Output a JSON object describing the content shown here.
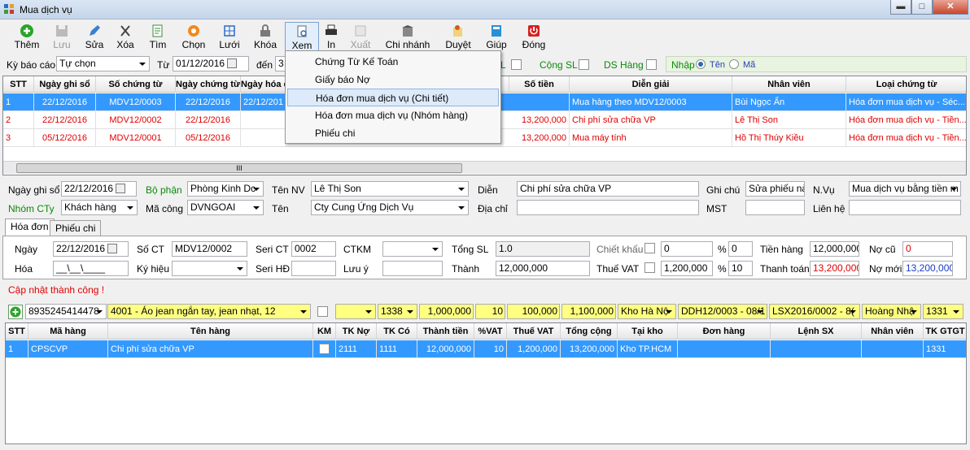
{
  "window": {
    "title": "Mua dịch vụ",
    "min": "▬",
    "max": "□",
    "close": "✕"
  },
  "toolbar": {
    "add": "Thêm",
    "save": "Lưu",
    "edit": "Sửa",
    "delete": "Xóa",
    "find": "Tìm",
    "choose": "Chọn",
    "grid": "Lưới",
    "lock": "Khóa",
    "view": "Xem",
    "print": "In",
    "export": "Xuất",
    "branch": "Chi nhánh",
    "approve": "Duyệt",
    "help": "Giúp",
    "close": "Đóng"
  },
  "filter": {
    "period_label": "Kỳ báo cáo",
    "period_value": "Tự chọn",
    "from_label": "Từ",
    "from_value": "01/12/2016",
    "to_label": "đến",
    "to_value": "3",
    "l_label": "L",
    "sum_qty_label": "Cộng SL",
    "ds_label": "DS Hàng",
    "input_label": "Nhập",
    "name_label": "Tên",
    "code_label": "Mã"
  },
  "view_menu": {
    "items": [
      "Chứng Từ Kế Toán",
      "Giấy báo Nợ",
      "Hóa đơn mua dịch vụ (Chi tiết)",
      "Hóa đơn mua dịch vụ (Nhóm hàng)",
      "Phiếu chi"
    ]
  },
  "top_grid": {
    "headers": [
      "STT",
      "Ngày ghi sổ",
      "Số chứng từ",
      "Ngày chứng từ",
      "Ngày hóa đ",
      "Số tiền",
      "Diễn giải",
      "Nhân viên",
      "Loại chứng từ"
    ],
    "rows": [
      {
        "stt": "1",
        "ngs": "22/12/2016",
        "sct": "MDV12/0003",
        "nct": "22/12/2016",
        "nhd": "22/12/201",
        "tien": "",
        "dg": "Mua hàng theo MDV12/0003",
        "nv": "Bùi Ngọc Ẩn",
        "loai": "Hóa đơn mua dịch vụ - Séc..."
      },
      {
        "stt": "2",
        "ngs": "22/12/2016",
        "sct": "MDV12/0002",
        "nct": "22/12/2016",
        "nhd": "",
        "tien": "13,200,000",
        "dg": "Chi phí sửa chữa VP",
        "nv": "Lê Thị Son",
        "loai": "Hóa đơn mua dịch vụ - Tiền..."
      },
      {
        "stt": "3",
        "ngs": "05/12/2016",
        "sct": "MDV12/0001",
        "nct": "05/12/2016",
        "nhd": "",
        "tien": "13,200,000",
        "dg": "Mua máy tính",
        "nv": "Hồ Thị Thúy Kiều",
        "loai": "Hóa đơn mua dịch vụ - Tiền..."
      }
    ],
    "scroll_marker": "III"
  },
  "form": {
    "ngs_label": "Ngày ghi sổ",
    "ngs_value": "22/12/2016",
    "bophan_label": "Bộ phận",
    "bophan_value": "Phòng Kinh Dc",
    "tennv_label": "Tên NV",
    "tennv_value": "Lê Thị Son",
    "dien_label": "Diễn",
    "dien_value": "Chi phí sửa chữa VP",
    "ghichu_label": "Ghi chú",
    "ghichu_value": "Sửa phiếu này",
    "nvu_label": "N.Vụ",
    "nvu_value": "Mua dịch vụ bằng tiền m",
    "nhomcty_label": "Nhóm CTy",
    "nhomcty_value": "Khách hàng",
    "macong_label": "Mã công",
    "macong_value": "DVNGOAI",
    "ten_label": "Tên",
    "ten_value": "Cty Cung Ứng Dịch Vụ",
    "diachi_label": "Địa chỉ",
    "mst_label": "MST",
    "lienhe_label": "Liên hệ"
  },
  "tabs": [
    "Hóa đơn",
    "Phiếu chi"
  ],
  "invoice": {
    "ngay_label": "Ngày",
    "ngay_value": "22/12/2016",
    "soct_label": "Số CT",
    "soct_value": "MDV12/0002",
    "serict_label": "Seri CT",
    "serict_value": "0002",
    "ctkm_label": "CTKM",
    "tongsl_label": "Tổng SL",
    "tongsl_value": "1.0",
    "ck_label": "Chiết khấu",
    "ck_value": "0",
    "pct": "%",
    "ck_pct": "0",
    "tienhang_label": "Tiền hàng",
    "tienhang_value": "12,000,000",
    "nocu_label": "Nợ cũ",
    "nocu_value": "0",
    "hoa_label": "Hóa",
    "hoa_value": "__\\__\\____",
    "kyhieu_label": "Ký hiệu",
    "serihd_label": "Seri HĐ",
    "luuy_label": "Lưu ý",
    "thanh_label": "Thành",
    "thanh_value": "12,000,000",
    "vat_label": "Thuế VAT",
    "vat_value": "1,200,000",
    "vat_pct": "10",
    "thanhtoan_label": "Thanh toán",
    "thanhtoan_value": "13,200,000",
    "nomoi_label": "Nợ mới",
    "nomoi_value": "13,200,000"
  },
  "status": "Cập nhật thành công !",
  "entry_row": {
    "barcode": "8935245414478",
    "item": "4001 - Áo jean ngắn tay, jean nhạt, 12",
    "tkno": "1338",
    "tien": "1,000,000",
    "sl": "10",
    "gia": "100,000",
    "tong": "1,100,000",
    "kho": "Kho Hà Nộ",
    "ddh": "DDH12/0003 - 08/1",
    "lsx": "LSX2016/0002 - 8(",
    "nv": "Hoàng Nhậ",
    "tkgtgt": "1331"
  },
  "detail_grid": {
    "headers": [
      "STT",
      "Mã hàng",
      "Tên hàng",
      "KM",
      "TK Nợ",
      "TK Có",
      "Thành tiền",
      "%VAT",
      "Thuế VAT",
      "Tổng cộng",
      "Tại kho",
      "Đơn hàng",
      "Lệnh SX",
      "Nhân viên",
      "TK GTGT"
    ],
    "rows": [
      {
        "stt": "1",
        "ma": "CPSCVP",
        "ten": "Chi phí sửa chữa VP",
        "tkno": "2111",
        "tkco": "1111",
        "tt": "12,000,000",
        "vat_pct": "10",
        "vat": "1,200,000",
        "tong": "13,200,000",
        "kho": "Kho TP.HCM",
        "dh": "",
        "lsx": "",
        "nv": "",
        "gtgt": "1331"
      }
    ]
  }
}
